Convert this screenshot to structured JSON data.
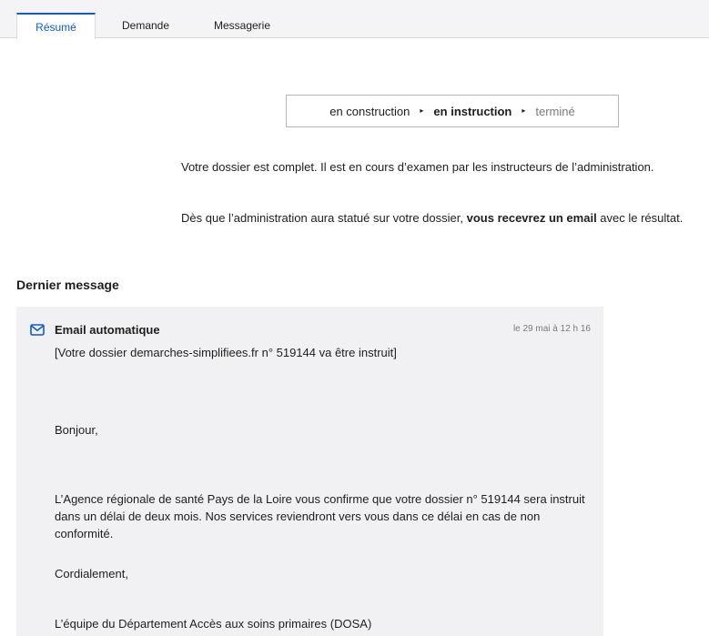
{
  "tabs": [
    {
      "label": "Résumé",
      "active": true
    },
    {
      "label": "Demande",
      "active": false
    },
    {
      "label": "Messagerie",
      "active": false
    }
  ],
  "status": {
    "step1": "en construction",
    "step2": "en instruction",
    "step3": "terminé",
    "separator": "▸"
  },
  "info": {
    "line1": "Votre dossier est complet. Il est en cours d’examen par les instructeurs de l’administration.",
    "line2_before": "Dès que l’administration aura statué sur votre dossier, ",
    "line2_bold": "vous recevrez un email",
    "line2_after": " avec le résultat."
  },
  "last_message": {
    "title": "Dernier message",
    "sender": "Email automatique",
    "date": "le 29 mai à 12 h 16",
    "subject": "[Votre dossier demarches-simplifiees.fr n° 519144 va être instruit]",
    "greeting": "Bonjour,",
    "body": "L’Agence régionale de santé Pays de la Loire vous confirme que votre dossier n° 519144 sera instruit dans un délai de deux mois. Nos services reviendront vers vous dans ce délai en cas de non conformité.",
    "closing": "Cordialement,",
    "signature": "L’équipe du Département Accès aux soins primaires (DOSA)"
  },
  "colors": {
    "accent": "#0b5cd5",
    "card_bg": "#f1f1f3"
  }
}
